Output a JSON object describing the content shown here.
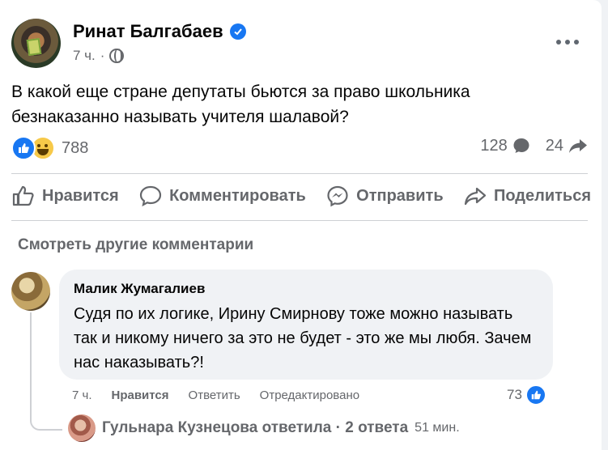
{
  "post": {
    "author": "Ринат Балгабаев",
    "time": "7 ч.",
    "separator": "·",
    "text": "В какой еще стране депутаты бьются за право школьника безнаказанно называть учителя шалавой?",
    "reactions_count": "788",
    "comments_count": "128",
    "shares_count": "24"
  },
  "actions": {
    "like": "Нравится",
    "comment": "Комментировать",
    "send": "Отправить",
    "share": "Поделиться"
  },
  "comments": {
    "see_more": "Смотреть другие комментарии",
    "first": {
      "author": "Малик Жумагалиев",
      "text": "Судя по их логике, Ирину Смирнову тоже можно называть так и никому ничего за это не будет - это же мы любя. Зачем нас наказывать?!",
      "time": "7 ч.",
      "like": "Нравится",
      "reply": "Ответить",
      "edited": "Отредактировано",
      "likes_count": "73"
    },
    "replies_summary": "Гульнара Кузнецова ответила · 2 ответа",
    "replies_time": "51 мин."
  },
  "colors": {
    "accent": "#1877f2",
    "secondary_text": "#65676b",
    "bubble": "#f0f2f5"
  }
}
